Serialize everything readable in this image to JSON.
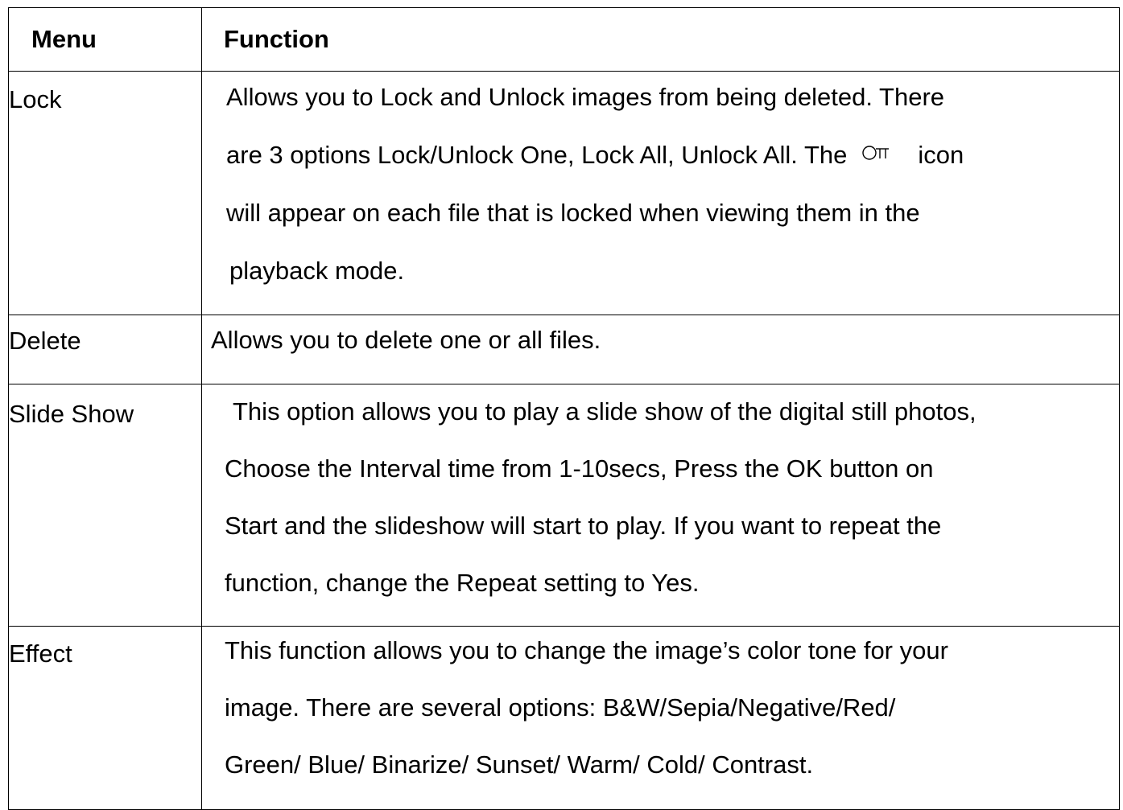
{
  "table": {
    "header": {
      "menu": "Menu",
      "function": "Function"
    },
    "rows": [
      {
        "menu": "Lock",
        "lines": [
          "Allows you to Lock and Unlock images from being deleted. There",
          "are 3 options Lock/Unlock One, Lock All, Unlock All. The",
          "icon",
          "will appear on each file that is locked when viewing them in the",
          "playback mode."
        ],
        "icon": "key-icon"
      },
      {
        "menu": "Delete",
        "lines": [
          "Allows you to delete one or all files."
        ]
      },
      {
        "menu": "Slide Show",
        "lines": [
          "This option allows you to play a slide show of the digital still photos,",
          "Choose the Interval time from 1-10secs, Press the OK button on",
          "Start and the slideshow will start to play. If you want to repeat the",
          "function, change the Repeat setting to Yes."
        ]
      },
      {
        "menu": "Effect",
        "lines": [
          "This function allows you to change the image’s color tone for your",
          "image. There are several options: B&W/Sepia/Negative/Red/",
          "Green/ Blue/ Binarize/ Sunset/ Warm/ Cold/ Contrast."
        ]
      }
    ]
  }
}
